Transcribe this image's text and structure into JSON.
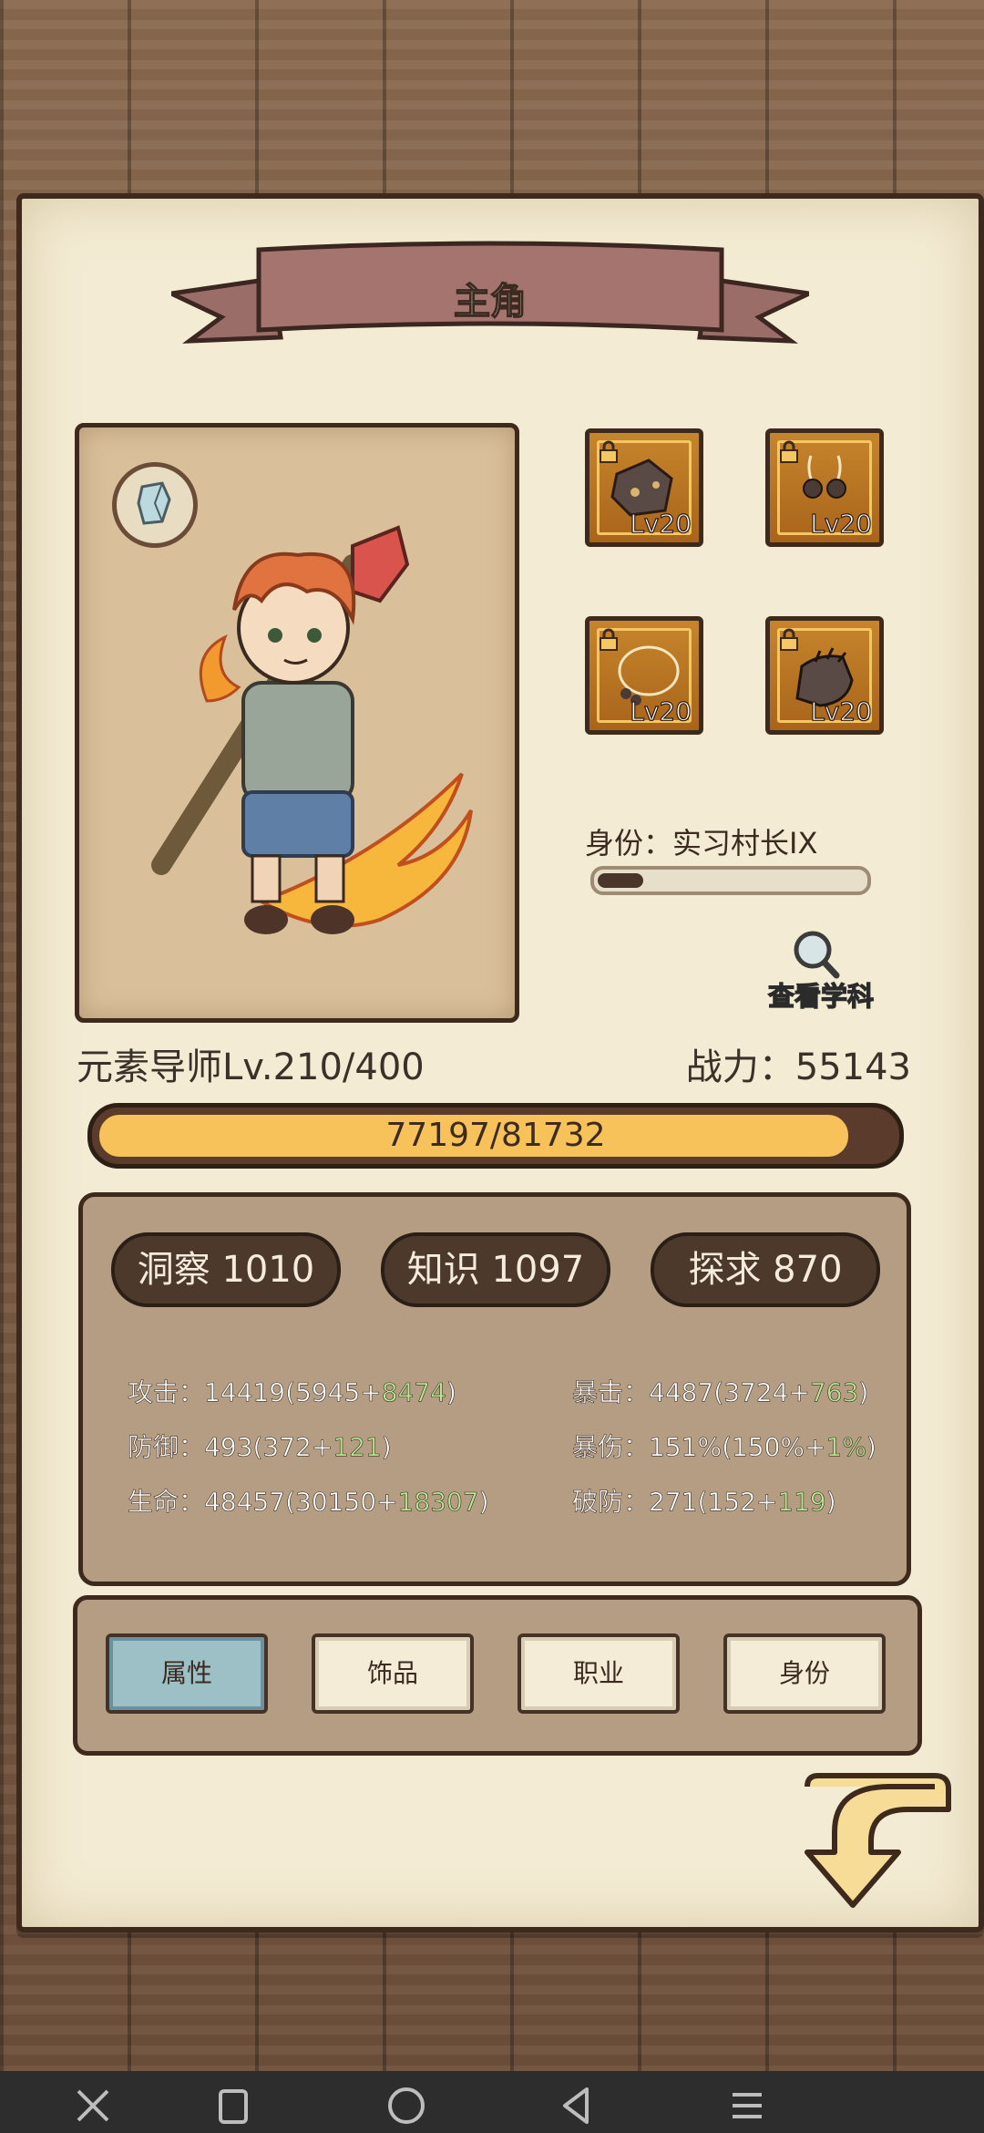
{
  "title": "主角",
  "equipment": [
    {
      "level": "Lv20",
      "icon": "ore-chunk-icon"
    },
    {
      "level": "Lv20",
      "icon": "earrings-icon"
    },
    {
      "level": "Lv20",
      "icon": "necklace-icon"
    },
    {
      "level": "Lv20",
      "icon": "gloves-icon"
    }
  ],
  "identity": {
    "label": "身份：实习村长IX",
    "progress_fraction": 0.17
  },
  "view_subject": "查看学科",
  "character": {
    "class_level": "元素导师Lv.210/400",
    "power": "战力：55143"
  },
  "exp": {
    "text": "77197/81732",
    "current": 77197,
    "max": 81732
  },
  "attributes": [
    {
      "label": "洞察 1010"
    },
    {
      "label": "知识 1097"
    },
    {
      "label": "探求 870"
    }
  ],
  "stats": {
    "attack": {
      "label": "攻击：",
      "base": "14419(5945+",
      "bonus": "8474",
      "end": ")"
    },
    "defense": {
      "label": "防御：",
      "base": "493(372+",
      "bonus": "121",
      "end": ")"
    },
    "hp": {
      "label": "生命：",
      "base": "48457(30150+",
      "bonus": "18307",
      "end": ")"
    },
    "crit": {
      "label": "暴击：",
      "base": "4487(3724+",
      "bonus": "763",
      "end": ")"
    },
    "crit_dmg": {
      "label": "暴伤：",
      "base": "151%(150%+",
      "bonus": "1%",
      "end": ")"
    },
    "armor_break": {
      "label": "破防：",
      "base": "271(152+",
      "bonus": "119",
      "end": ")"
    }
  },
  "tabs": [
    {
      "label": "属性",
      "active": true
    },
    {
      "label": "饰品",
      "active": false
    },
    {
      "label": "职业",
      "active": false
    },
    {
      "label": "身份",
      "active": false
    }
  ],
  "colors": {
    "accent": "#f7c25a",
    "bonus_green": "#b7e893",
    "active_tab": "#9dc0c6"
  }
}
